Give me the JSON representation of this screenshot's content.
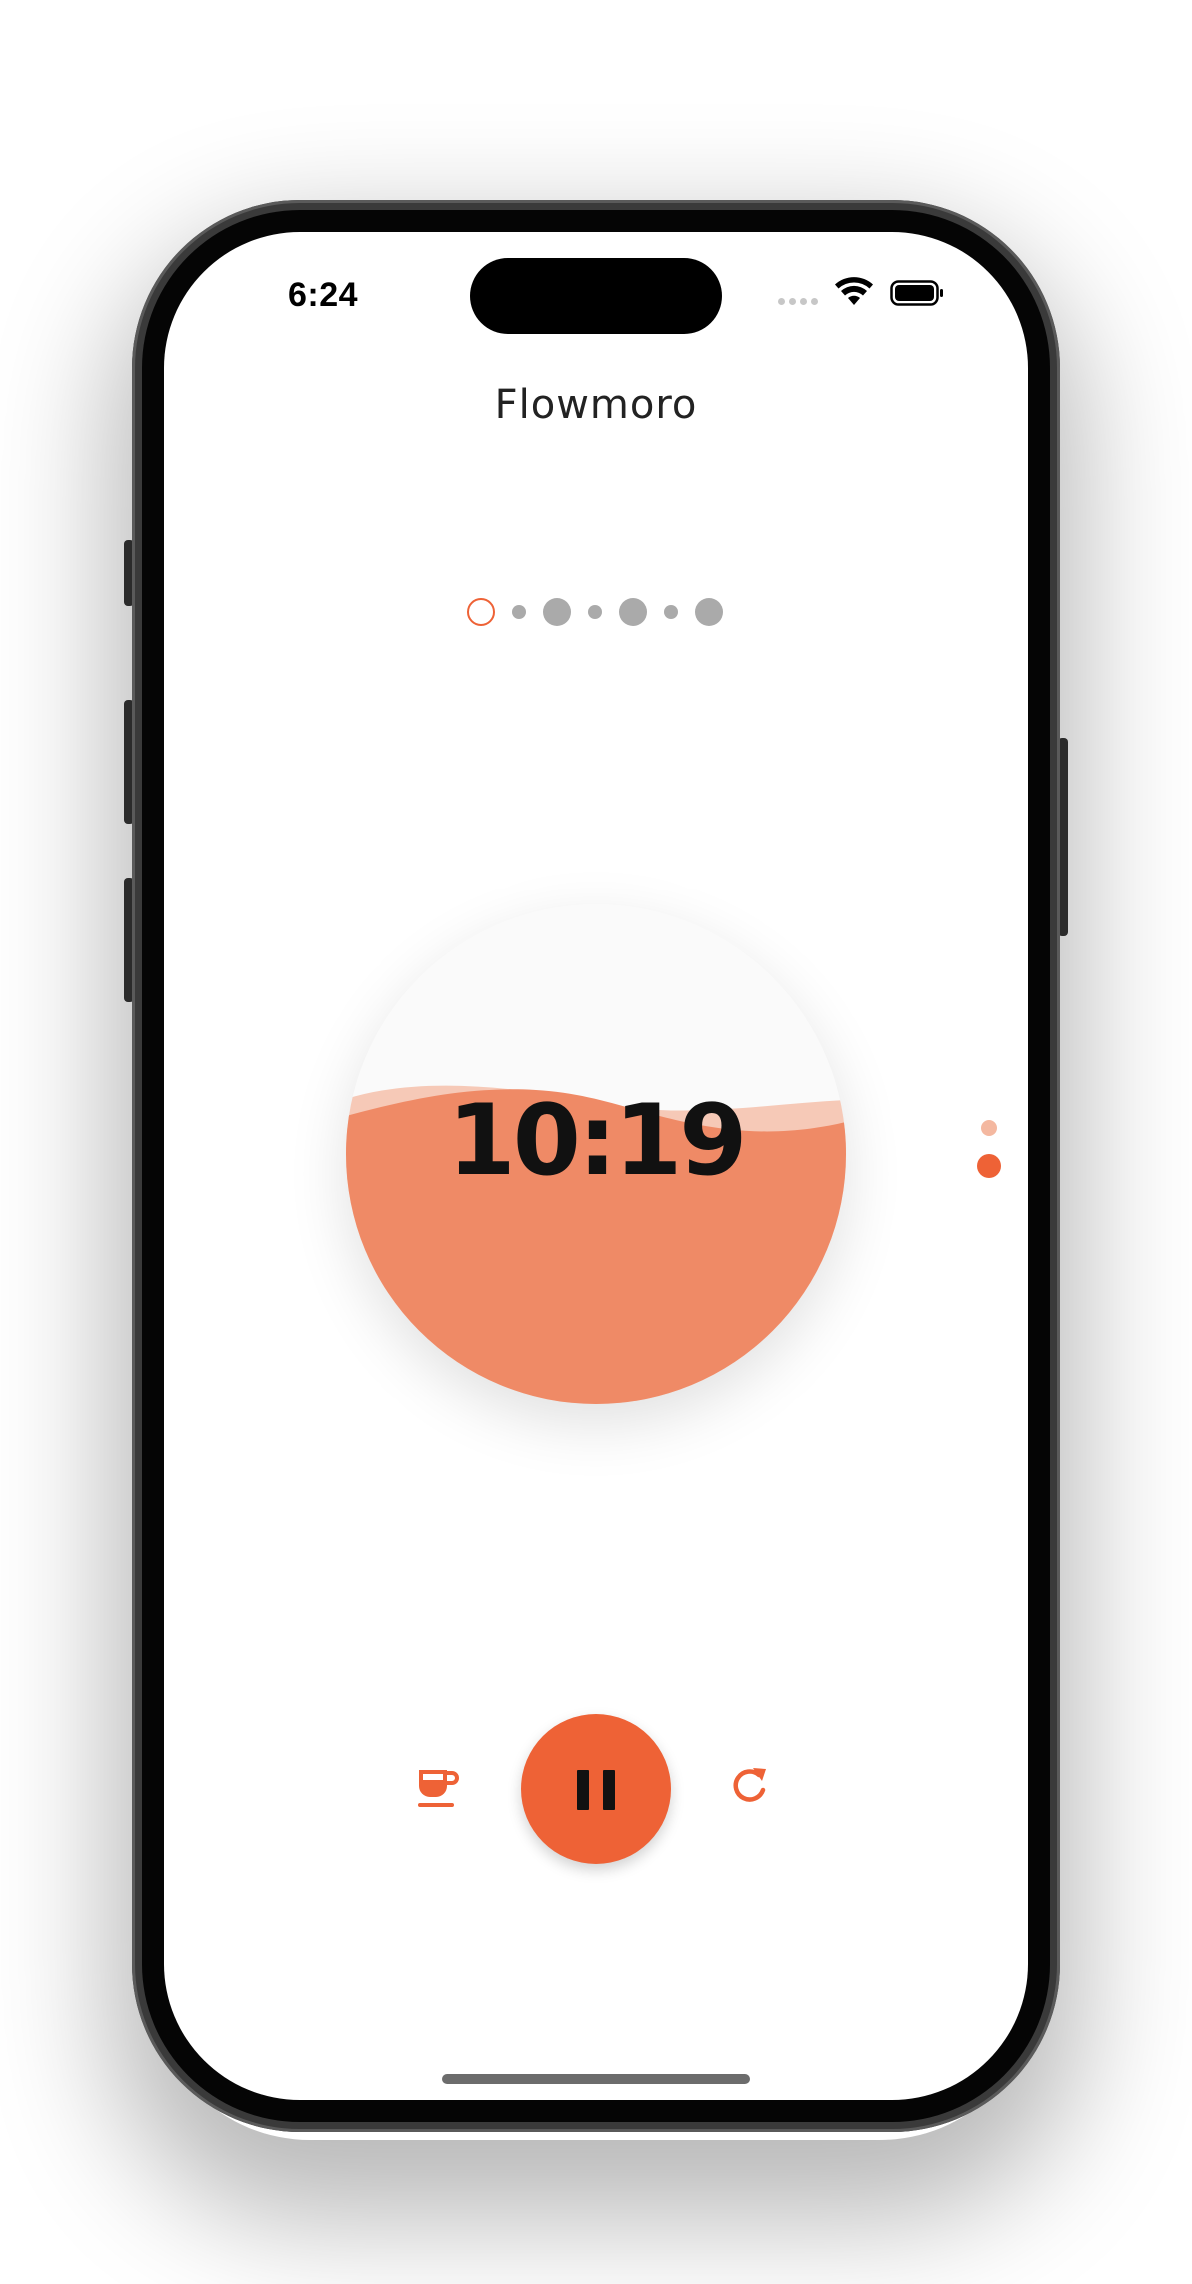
{
  "status_bar": {
    "time": "6:24",
    "icons": [
      "cellular-signal-icon",
      "wifi-icon",
      "battery-icon"
    ]
  },
  "app": {
    "title": "Flowmoro"
  },
  "session_progress": {
    "total_steps": 7,
    "current_step": 1,
    "step_kinds": [
      "focus",
      "short-break",
      "focus",
      "short-break",
      "focus",
      "short-break",
      "focus"
    ]
  },
  "timer": {
    "display": "10:19",
    "fill_level": 0.5
  },
  "page_indicator": {
    "pages": 2,
    "active_page": 2
  },
  "controls": {
    "break_icon": "coffee-icon",
    "primary_icon": "pause-icon",
    "reset_icon": "refresh-icon"
  },
  "colors": {
    "accent": "#ee6236",
    "wave_fill": "#ef8a66",
    "wave_light": "#f4b8a0",
    "inactive_dot": "#aaaaaa",
    "text": "#111111"
  }
}
